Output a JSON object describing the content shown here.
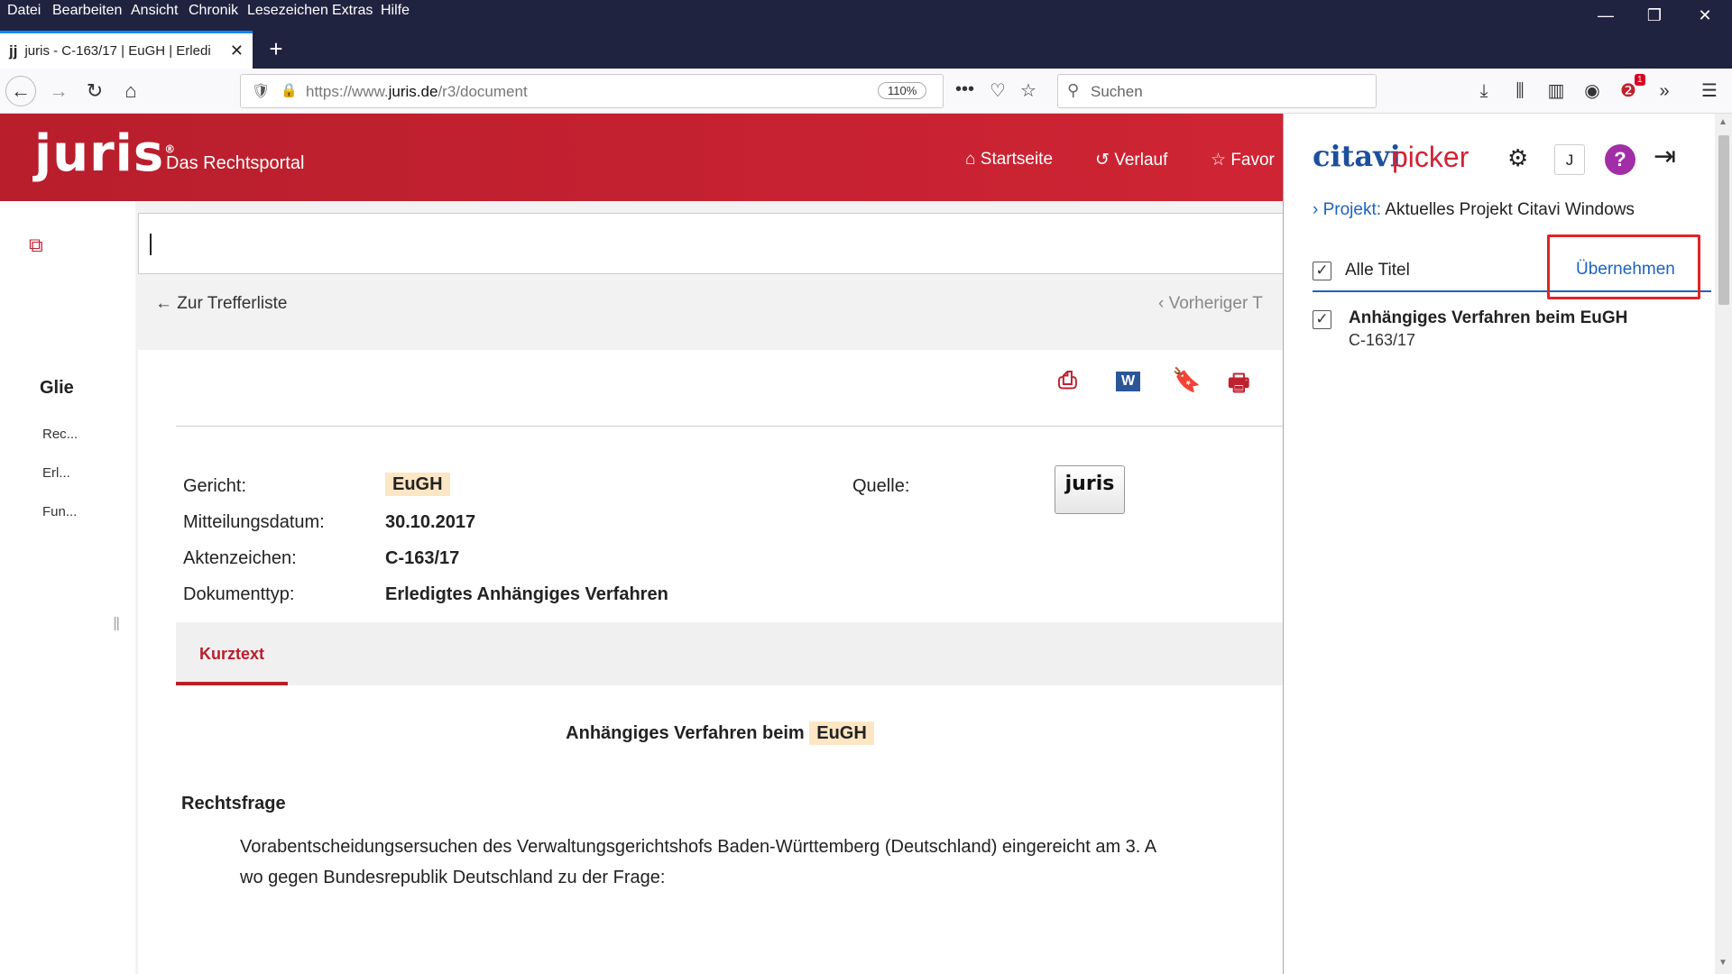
{
  "browser": {
    "menu": [
      "Datei",
      "Bearbeiten",
      "Ansicht",
      "Chronik",
      "Lesezeichen",
      "Extras",
      "Hilfe"
    ],
    "window_controls": {
      "minimize": "—",
      "maximize": "❐",
      "close": "✕"
    },
    "tab": {
      "favicon": "jj",
      "title": "juris - C-163/17 | EuGH | Erledi",
      "close": "✕"
    },
    "newtab": "+",
    "url": {
      "prefix": "https://www.",
      "domain": "juris.de",
      "path": "/r3/document"
    },
    "zoom": "110%",
    "search_placeholder": "Suchen",
    "notification_count": "1"
  },
  "juris": {
    "logo": "juris",
    "logo_mark": "®",
    "tagline": "Das Rechtsportal",
    "nav": [
      "Startseite",
      "Verlauf",
      "Favor"
    ],
    "toc_title": "Glie",
    "toc_items": [
      "Rec...",
      "Erl...",
      "Fun..."
    ],
    "back_link": "Zur Trefferliste",
    "prev_link": "Vorheriger T",
    "meta": [
      {
        "label": "Gericht:",
        "value": "EuGH"
      },
      {
        "label": "Mitteilungsdatum:",
        "value": "30.10.2017"
      },
      {
        "label": "Aktenzeichen:",
        "value": "C-163/17"
      },
      {
        "label": "Dokumenttyp:",
        "value": "Erledigtes Anhängiges Verfahren"
      }
    ],
    "quelle_label": "Quelle:",
    "quelle_badge": "juris",
    "tab_kurztext": "Kurztext",
    "headline_prefix": "Anhängiges Verfahren beim",
    "headline_court": "EuGH",
    "section_title": "Rechtsfrage",
    "paragraph": [
      "Vorabentscheidungsersuchen des Verwaltungsgerichtshofs Baden-Württemberg (Deutschland) eingereicht am 3. A",
      "wo gegen Bundesrepublik Deutschland zu der Frage:"
    ]
  },
  "citavi": {
    "logo_left": "citavi",
    "logo_right": "picker",
    "user_initial": "J",
    "help": "?",
    "project_label": "Projekt:",
    "project_name": "Aktuelles Projekt Citavi Windows",
    "all_titles": "Alle Titel",
    "apply": "Übernehmen",
    "item": {
      "title": "Anhängiges Verfahren beim EuGH",
      "subtitle": "C-163/17"
    }
  },
  "colors": {
    "juris_red": "#c0212f",
    "citavi_blue": "#1d4f9c",
    "highlight": "#fde6c4",
    "annotation_red": "#e02424"
  }
}
